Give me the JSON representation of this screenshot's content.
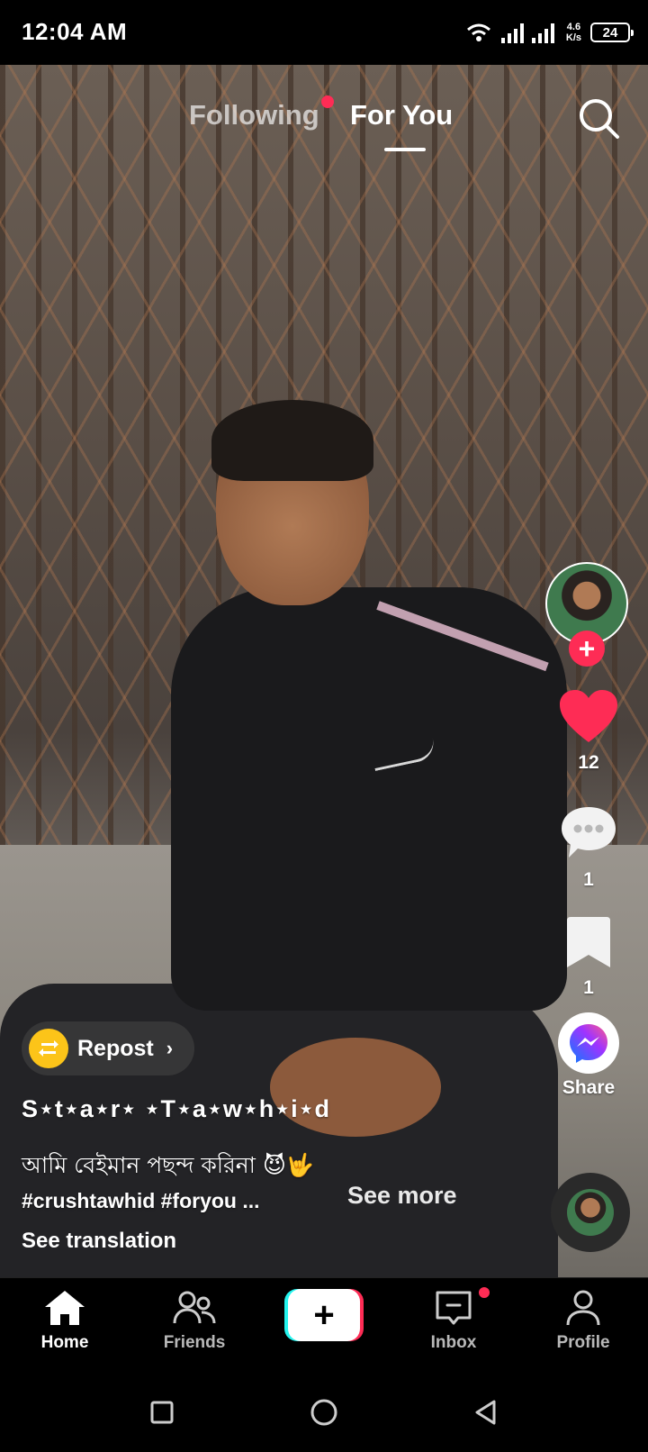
{
  "status_bar": {
    "time": "12:04 AM",
    "speed_value": "4.6",
    "speed_unit": "K/s",
    "battery": "24"
  },
  "top_tabs": {
    "following": "Following",
    "for_you": "For You",
    "active": "For You"
  },
  "rail": {
    "likes": "12",
    "comments": "1",
    "favorites": "1",
    "share_label": "Share"
  },
  "repost": {
    "label": "Repost"
  },
  "post": {
    "username": "S⋆t⋆a⋆r⋆ ⋆T⋆a⋆w⋆h⋆i⋆d",
    "caption": "আমি বেইমান পছন্দ করিনা 😈🤟",
    "hashtags": "#crushtawhid #foryou ...",
    "see_more": "See more",
    "see_translation": "See translation"
  },
  "bottom_nav": {
    "home": "Home",
    "friends": "Friends",
    "inbox": "Inbox",
    "profile": "Profile",
    "active": "Home"
  },
  "colors": {
    "accent_red": "#fe2c55",
    "accent_cyan": "#25f4ee",
    "repost_yellow": "#fcc419",
    "messenger_blue": "#5b5bff"
  },
  "icons": {
    "search": "search-icon",
    "like": "heart-icon",
    "comment": "comment-icon",
    "favorite": "bookmark-icon",
    "share": "messenger-icon",
    "repost": "repost-icon",
    "home": "home-icon",
    "friends": "friends-icon",
    "create": "plus-icon",
    "inbox": "inbox-icon",
    "profile": "profile-icon"
  }
}
